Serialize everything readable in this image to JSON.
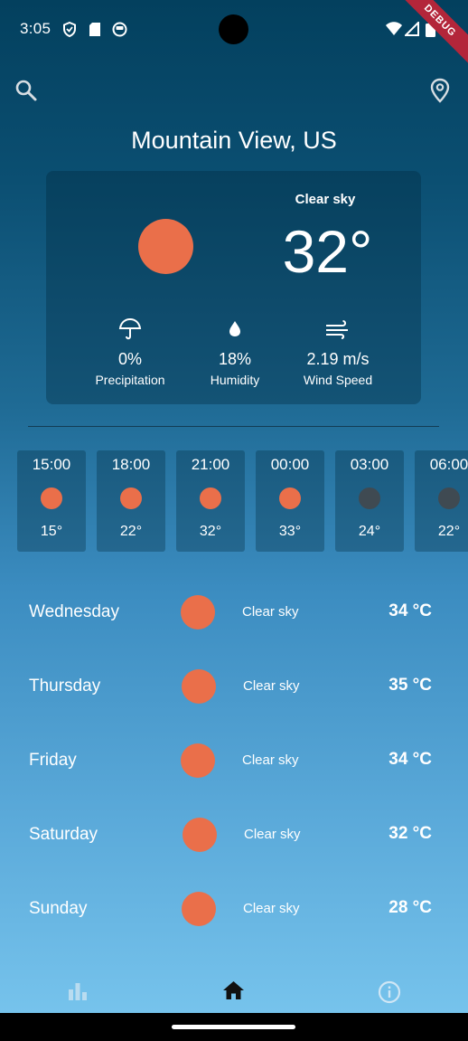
{
  "status_bar": {
    "time": "3:05"
  },
  "debug_label": "DEBUG",
  "location": "Mountain View, US",
  "current": {
    "condition": "Clear sky",
    "temperature": "32°",
    "stats": [
      {
        "icon": "umbrella-icon",
        "value": "0%",
        "label": "Precipitation"
      },
      {
        "icon": "droplet-icon",
        "value": "18%",
        "label": "Humidity"
      },
      {
        "icon": "wind-icon",
        "value": "2.19 m/s",
        "label": "Wind Speed"
      }
    ]
  },
  "hourly": [
    {
      "time": "15:00",
      "temp": "15°",
      "dot_color": "#ea6f4a"
    },
    {
      "time": "18:00",
      "temp": "22°",
      "dot_color": "#ea6f4a"
    },
    {
      "time": "21:00",
      "temp": "32°",
      "dot_color": "#ea6f4a"
    },
    {
      "time": "00:00",
      "temp": "33°",
      "dot_color": "#ea6f4a"
    },
    {
      "time": "03:00",
      "temp": "24°",
      "dot_color": "#3f4a52"
    },
    {
      "time": "06:00",
      "temp": "22°",
      "dot_color": "#3f4a52"
    }
  ],
  "daily": [
    {
      "day": "Wednesday",
      "condition": "Clear sky",
      "temp": "34 °C"
    },
    {
      "day": "Thursday",
      "condition": "Clear sky",
      "temp": "35 °C"
    },
    {
      "day": "Friday",
      "condition": "Clear sky",
      "temp": "34 °C"
    },
    {
      "day": "Saturday",
      "condition": "Clear sky",
      "temp": "32 °C"
    },
    {
      "day": "Sunday",
      "condition": "Clear sky",
      "temp": "28 °C"
    }
  ],
  "colors": {
    "sun": "#ea6f4a",
    "night": "#3f4a52"
  },
  "nav": [
    {
      "icon": "bar-chart-icon",
      "active": false
    },
    {
      "icon": "home-icon",
      "active": true
    },
    {
      "icon": "info-icon",
      "active": false
    }
  ]
}
